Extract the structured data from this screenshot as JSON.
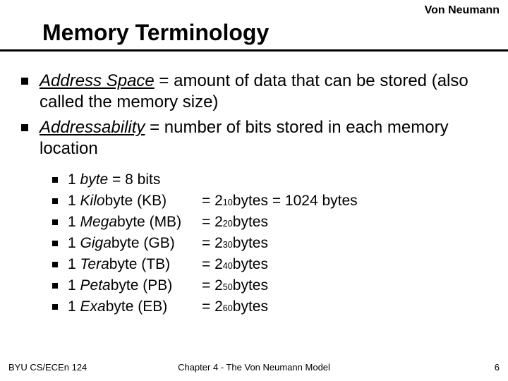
{
  "header_label": "Von Neumann",
  "title": "Memory Terminology",
  "bullets": [
    {
      "term": "Address Space",
      "rest": " = amount of data that can be stored (also called the memory size)"
    },
    {
      "term": "Addressability",
      "rest": " = number of bits stored in each memory location"
    }
  ],
  "units": [
    {
      "prefix": "1 ",
      "ital": "byte",
      "rest": "   = 8 bits",
      "eq_prefix": "",
      "exp": "",
      "eq_suffix": ""
    },
    {
      "prefix": "1 ",
      "ital": "Kilo",
      "rest": "byte (KB)",
      "eq_prefix": "= 2",
      "exp": "10",
      "eq_suffix": " bytes = 1024 bytes"
    },
    {
      "prefix": "1 ",
      "ital": "Mega",
      "rest": "byte (MB)",
      "eq_prefix": "= 2",
      "exp": "20",
      "eq_suffix": " bytes"
    },
    {
      "prefix": "1 ",
      "ital": "Giga",
      "rest": "byte (GB)",
      "eq_prefix": "= 2",
      "exp": "30",
      "eq_suffix": " bytes"
    },
    {
      "prefix": "1 ",
      "ital": "Tera",
      "rest": "byte (TB)",
      "eq_prefix": "= 2",
      "exp": "40",
      "eq_suffix": " bytes"
    },
    {
      "prefix": "1 ",
      "ital": "Peta",
      "rest": "byte (PB)",
      "eq_prefix": "= 2",
      "exp": "50",
      "eq_suffix": " bytes"
    },
    {
      "prefix": "1 ",
      "ital": "Exa",
      "rest": "byte (EB)",
      "eq_prefix": "= 2",
      "exp": "60",
      "eq_suffix": " bytes"
    }
  ],
  "footer": {
    "left": "BYU CS/ECEn 124",
    "center": "Chapter 4 - The Von Neumann Model",
    "right": "6"
  }
}
